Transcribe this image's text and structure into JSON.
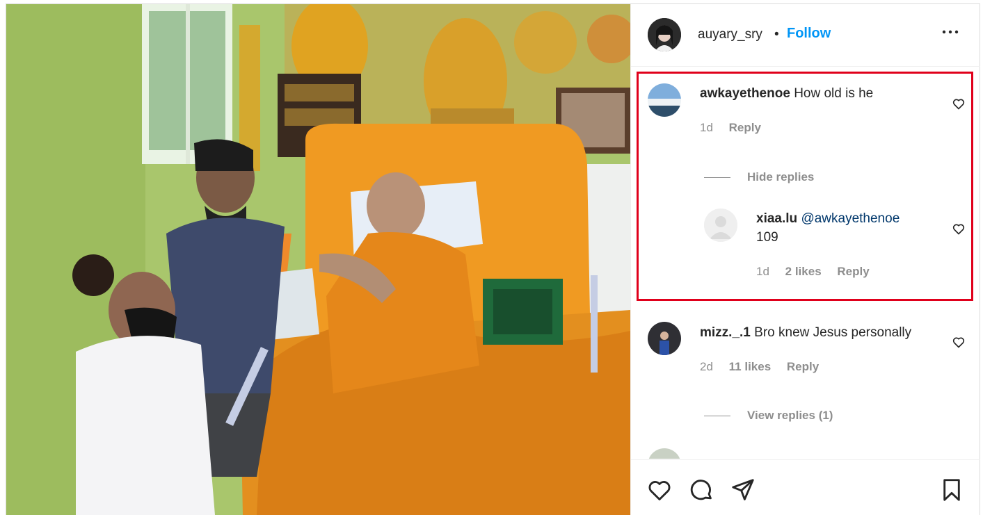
{
  "post": {
    "author": "auyary_sry",
    "separator": "•",
    "follow_label": "Follow",
    "more_label": "•••"
  },
  "comments": [
    {
      "username": "awkayethenoe",
      "text": "How old is he",
      "age": "1d",
      "reply_label": "Reply",
      "toggle_label": "Hide replies",
      "replies": [
        {
          "username": "xiaa.lu",
          "mention": "@awkayethenoe",
          "text": "109",
          "age": "1d",
          "likes": "2 likes",
          "reply_label": "Reply"
        }
      ]
    },
    {
      "username": "mizz._.1",
      "text": "Bro knew Jesus personally",
      "age": "2d",
      "likes": "11 likes",
      "reply_label": "Reply",
      "toggle_label": "View replies (1)"
    }
  ],
  "colors": {
    "follow": "#0095f6",
    "highlight": "#e0001b",
    "mention": "#00376b",
    "muted": "#8e8e8e"
  },
  "icons": {
    "like": "heart-icon",
    "comment": "comment-icon",
    "share": "share-icon",
    "save": "bookmark-icon"
  }
}
